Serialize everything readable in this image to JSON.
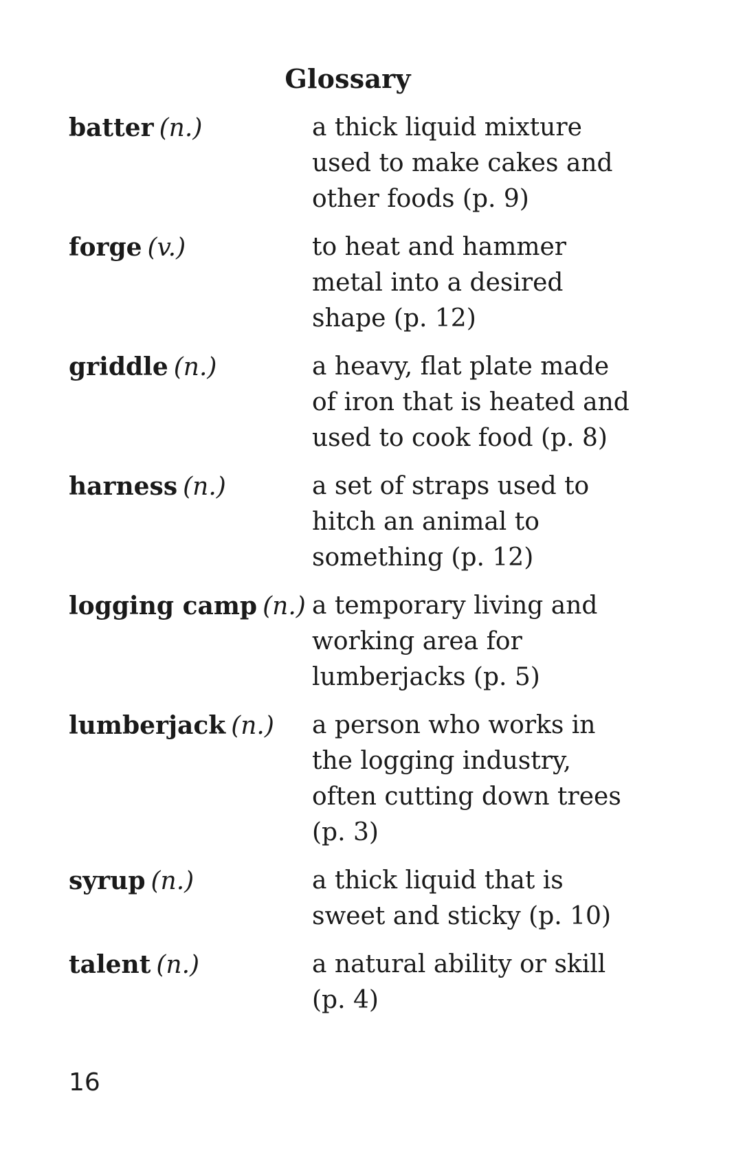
{
  "title": "Glossary",
  "entries": [
    {
      "term": "batter",
      "pos": "(n.)",
      "definition": [
        "a thick liquid mixture",
        "used to make cakes and",
        "other foods (p. 9)"
      ]
    },
    {
      "term": "forge",
      "pos": "(v.)",
      "definition": [
        "to heat and hammer",
        "metal into a desired",
        "shape (p. 12)"
      ]
    },
    {
      "term": "griddle",
      "pos": "(n.)",
      "definition": [
        "a heavy, flat plate made",
        "of iron that is heated and",
        "used to cook food (p. 8)"
      ]
    },
    {
      "term": "harness",
      "pos": "(n.)",
      "definition": [
        "a set of straps used to",
        "hitch an animal to",
        "something (p. 12)"
      ]
    },
    {
      "term": "logging camp",
      "pos": "(n.)",
      "definition": [
        "a temporary living and",
        "working area for",
        "lumberjacks (p. 5)"
      ]
    },
    {
      "term": "lumberjack",
      "pos": "(n.)",
      "definition": [
        "a person who works in",
        "the logging industry,",
        "often cutting down trees",
        "(p. 3)"
      ]
    },
    {
      "term": "syrup",
      "pos": "(n.)",
      "definition": [
        "a thick liquid that is",
        "sweet and sticky (p. 10)"
      ]
    },
    {
      "term": "talent",
      "pos": "(n.)",
      "definition": [
        "a natural ability or skill",
        "(p. 4)"
      ]
    }
  ],
  "page_number": "16"
}
